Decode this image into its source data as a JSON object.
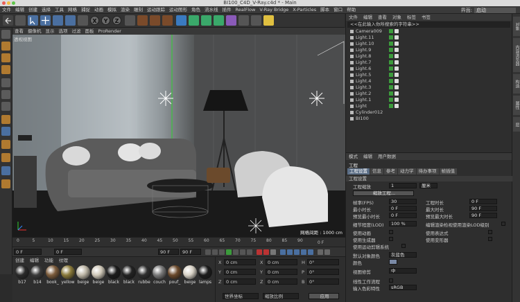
{
  "window": {
    "title": "BI100_C4D_V-Ray.c4d * - Main"
  },
  "menubar": {
    "items": [
      "文件",
      "编辑",
      "创建",
      "选择",
      "工具",
      "网格",
      "捕捉",
      "动画",
      "模拟",
      "渲染",
      "雕刻",
      "运动跟踪",
      "运动图形",
      "角色",
      "流水线",
      "插件",
      "RealFlow",
      "V-Ray Bridge",
      "X-Particles",
      "脚本",
      "窗口",
      "帮助"
    ],
    "interface_label": "界面:",
    "interface_value": "启动"
  },
  "viewport": {
    "menu": [
      "查看",
      "摄像机",
      "显示",
      "选项",
      "过滤",
      "面板",
      "ProRender"
    ],
    "view_label": "透视视图",
    "grid_status": "网格间距 : 1000 cm"
  },
  "timeline": {
    "ticks": [
      "0",
      "5",
      "10",
      "15",
      "20",
      "25",
      "30",
      "35",
      "40",
      "45",
      "50",
      "55",
      "60",
      "65",
      "70",
      "75",
      "80",
      "85",
      "90"
    ],
    "end_frame_label": "0 F"
  },
  "playback": {
    "current_frame": "0 F",
    "start_frame": "0 F",
    "end_frame": "90 F",
    "end_frame2": "90 F"
  },
  "materials": {
    "menu": [
      "创建",
      "编辑",
      "功能",
      "纹理"
    ],
    "items": [
      {
        "label": "b17",
        "color": "#2a2a2a"
      },
      {
        "label": "b14",
        "color": "#3a3a3a"
      },
      {
        "label": "book_",
        "color": "#7c5c3c"
      },
      {
        "label": "yellow",
        "color": "#8a7a3a"
      },
      {
        "label": "beige",
        "color": "#bdb6a6"
      },
      {
        "label": "beige",
        "color": "#cfc8b8"
      },
      {
        "label": "black",
        "color": "#1c1c1c"
      },
      {
        "label": "black",
        "color": "#232323"
      },
      {
        "label": "rubbe",
        "color": "#2f2f2f"
      },
      {
        "label": "couch",
        "color": "#7a7a7a"
      },
      {
        "label": "pouf_",
        "color": "#6b4a2c"
      },
      {
        "label": "beige",
        "color": "#d8d2c6"
      },
      {
        "label": "lamps",
        "color": "#1b1b1b"
      }
    ]
  },
  "coordinates": {
    "rows": [
      {
        "axis": "X",
        "pos": "0 cm",
        "axis2": "X",
        "size": "0 cm",
        "rot_axis": "H",
        "rot": "0°"
      },
      {
        "axis": "Y",
        "pos": "0 cm",
        "axis2": "Y",
        "size": "0 cm",
        "rot_axis": "P",
        "rot": "0°"
      },
      {
        "axis": "Z",
        "pos": "0 cm",
        "axis2": "Z",
        "size": "0 cm",
        "rot_axis": "B",
        "rot": "0°"
      }
    ],
    "mode": "世界坐标",
    "scale": "缩放比例",
    "apply": "应用"
  },
  "objects": {
    "menu": [
      "文件",
      "编辑",
      "查看",
      "对象",
      "标签",
      "书签"
    ],
    "search_placeholder": "<<在此输入你所搜索的字符串>>",
    "items": [
      "Camera009",
      "Light.11",
      "Light.10",
      "Light.9",
      "Light.8",
      "Light.7",
      "Light.6",
      "Light.5",
      "Light.4",
      "Light.3",
      "Light.2",
      "Light.1",
      "Light",
      "Cylinder012",
      "BI100"
    ]
  },
  "right_tabs": [
    "对象",
    "内容浏览器",
    "构造",
    "属性",
    "层"
  ],
  "attributes": {
    "menu": [
      "模式",
      "编辑",
      "用户数据"
    ],
    "title": "工程",
    "tabs": [
      "工程设置",
      "信息",
      "参考",
      "动力学",
      "待办事项",
      "帧插值"
    ],
    "section_settings": "工程设置",
    "scale_label": "工程缩放",
    "scale_value": "1",
    "scale_unit": "厘米",
    "scale_button": "缩放工程...",
    "fps_label": "帧率(FPS)",
    "fps_value": "30",
    "duration_label": "工程时长",
    "duration_value": "0 F",
    "min_time_label": "最小时长",
    "min_time_value": "0 F",
    "max_time_label": "最大时长",
    "max_time_value": "90 F",
    "preview_min_label": "预览最小时长",
    "preview_min_value": "0 F",
    "preview_max_label": "预览最大时长",
    "preview_max_value": "90 F",
    "lod_label": "细节程度(LOD)",
    "lod_value": "100 %",
    "lod_render_label": "编辑渲染检视使用渲染LOD级别",
    "use_anim_label": "使用动画",
    "use_expr_label": "使用表达式",
    "use_gen_label": "使用生成器",
    "use_deform_label": "使用变形器",
    "use_motion_label": "使用运动剪辑系统",
    "default_color_label": "默认对象颜色",
    "default_color_value": "灰蓝色",
    "color_label": "颜色",
    "view_clip_label": "视图修剪",
    "view_clip_value": "中",
    "linear_label": "线性工作流程",
    "input_color_label": "输入色彩特性",
    "input_color_value": "sRGB"
  }
}
